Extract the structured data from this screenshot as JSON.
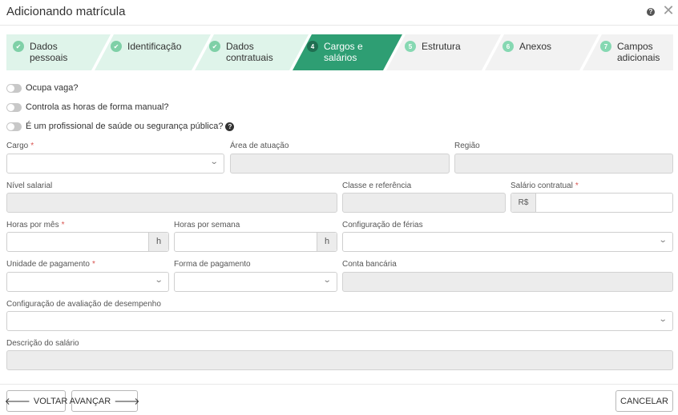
{
  "header": {
    "title": "Adicionando matrícula",
    "help_icon": "?",
    "close_icon": "✕"
  },
  "steps": [
    {
      "badge": "✔",
      "label": "Dados pessoais",
      "state": "done"
    },
    {
      "badge": "✔",
      "label": "Identificação",
      "state": "done"
    },
    {
      "badge": "✔",
      "label": "Dados contratuais",
      "state": "done"
    },
    {
      "badge": "4",
      "label": "Cargos e salários",
      "state": "active"
    },
    {
      "badge": "5",
      "label": "Estrutura",
      "state": "todo"
    },
    {
      "badge": "6",
      "label": "Anexos",
      "state": "todo"
    },
    {
      "badge": "7",
      "label": "Campos adicionais",
      "state": "todo"
    }
  ],
  "toggles": {
    "ocupa_vaga": "Ocupa vaga?",
    "controla_horas": "Controla as horas de forma manual?",
    "profissional_saude": "É um profissional de saúde ou segurança pública?"
  },
  "form": {
    "cargo": {
      "label": "Cargo",
      "value": ""
    },
    "area_atuacao": {
      "label": "Área de atuação",
      "value": ""
    },
    "regiao": {
      "label": "Região",
      "value": ""
    },
    "nivel_salarial": {
      "label": "Nível salarial",
      "value": ""
    },
    "classe_referencia": {
      "label": "Classe e referência",
      "value": ""
    },
    "salario_contratual": {
      "label": "Salário contratual",
      "prefix": "R$",
      "value": ""
    },
    "horas_mes": {
      "label": "Horas por mês",
      "suffix": "h",
      "value": ""
    },
    "horas_semana": {
      "label": "Horas por semana",
      "suffix": "h",
      "value": ""
    },
    "config_ferias": {
      "label": "Configuração de férias",
      "value": ""
    },
    "unidade_pagamento": {
      "label": "Unidade de pagamento",
      "value": ""
    },
    "forma_pagamento": {
      "label": "Forma de pagamento",
      "value": ""
    },
    "conta_bancaria": {
      "label": "Conta bancária",
      "value": ""
    },
    "config_avaliacao": {
      "label": "Configuração de avaliação de desempenho",
      "value": ""
    },
    "descricao_salario": {
      "label": "Descrição do salário",
      "value": ""
    }
  },
  "required_mark": "*",
  "footer": {
    "voltar": "VOLTAR",
    "avancar": "AVANÇAR",
    "cancelar": "CANCELAR"
  },
  "colors": {
    "step_done_bg": "#dff4ea",
    "step_active_bg": "#2e9e73",
    "step_todo_bg": "#f2f2f2",
    "required": "#d9534f"
  }
}
